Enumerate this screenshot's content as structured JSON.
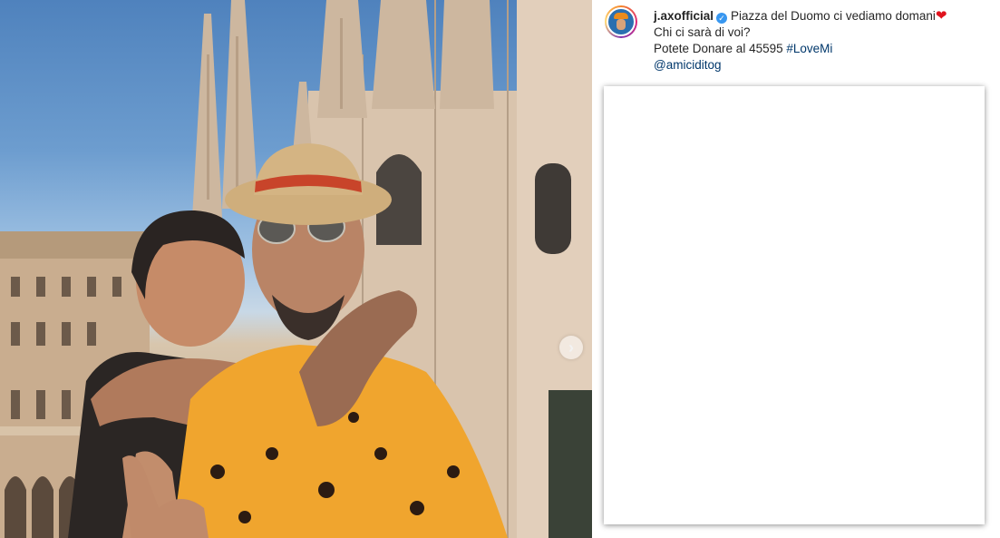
{
  "post": {
    "username": "j.axofficial",
    "caption_line1": "Piazza del Duomo ci vediamo domani",
    "caption_line2": "Chi ci sarà di voi?",
    "caption_line3_text": "Potete Donare al 45595 ",
    "hashtag": "#LoveMi",
    "mention": "@amiciditog"
  },
  "icons": {
    "verified": "verified-badge-icon",
    "heart": "red-heart-emoji",
    "next": "chevron-right-icon"
  },
  "colors": {
    "link": "#00376b",
    "verified": "#3897f0",
    "heart": "#e0141e"
  }
}
